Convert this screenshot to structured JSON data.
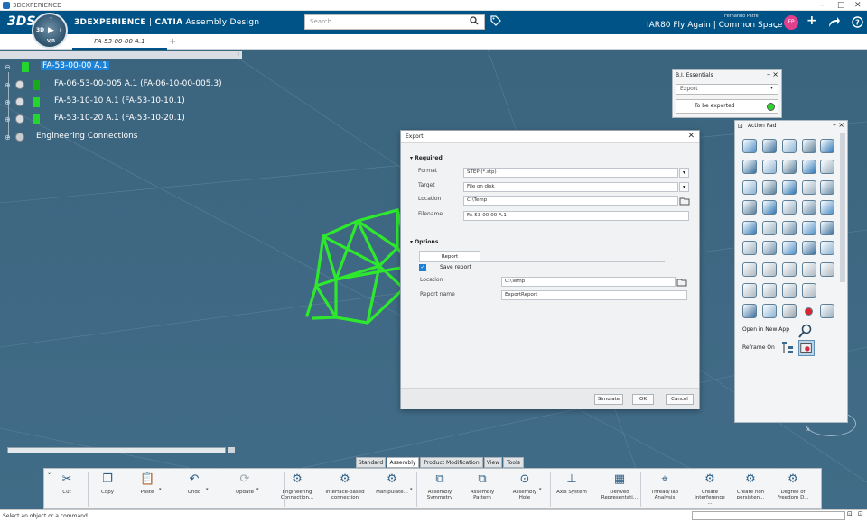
{
  "window": {
    "title": "3DEXPERIENCE",
    "controls": [
      "–",
      "□",
      "✕"
    ]
  },
  "header": {
    "logo": "3DS",
    "compass": {
      "top": "?",
      "center": "▶",
      "bottom": "V,R",
      "left": "3D",
      "right": "i"
    },
    "brand": "3DEXPERIENCE",
    "app": "CATIA",
    "app_module": "Assembly Design",
    "search_placeholder": "Search",
    "user_name": "Fernando Patre",
    "collab_space": "IAR80 Fly Again | Common Space",
    "avatar_initials": "FP"
  },
  "tabs": {
    "document": "FA-53-00-00 A.1",
    "add": "+"
  },
  "tree": {
    "root": "FA-53-00-00 A.1",
    "items": [
      "FA-06-53-00-005 A.1 (FA-06-10-00-005.3)",
      "FA-53-10-10 A.1 (FA-53-10-10.1)",
      "FA-53-10-20 A.1 (FA-53-10-20.1)",
      "Engineering Connections"
    ],
    "collapse_icon": "‹"
  },
  "bi_essentials": {
    "title": "B.I. Essentials",
    "selected": "Export",
    "legend": "To be exported",
    "legend_color": "#2cd52c"
  },
  "action_pad": {
    "title": "Action Pad",
    "open_new_app": "Open in New App",
    "reframe_on": "Reframe On"
  },
  "export_dialog": {
    "title": "Export",
    "required_label": "Required",
    "format_label": "Format",
    "format_value": "STEP (*.stp)",
    "target_label": "Target",
    "target_value": "File on disk",
    "location_label": "Location",
    "location_value": "C:\\Temp",
    "filename_label": "Filename",
    "filename_value": "FA-53-00-00 A.1",
    "options_label": "Options",
    "report_tab": "Report",
    "save_report_label": "Save report",
    "report_location_label": "Location",
    "report_location_value": "C:\\Temp",
    "report_name_label": "Report name",
    "report_name_value": "ExportReport",
    "simulate": "Simulate",
    "ok": "OK",
    "cancel": "Cancel"
  },
  "section_tabs": [
    "Standard",
    "Assembly",
    "Product Modification",
    "View",
    "Tools"
  ],
  "toolbar": [
    {
      "label": "Cut"
    },
    {
      "label": "Copy"
    },
    {
      "label": "Paste"
    },
    {
      "label": "Undo"
    },
    {
      "label": "Update"
    },
    {
      "label": "Engineering Connection..."
    },
    {
      "label": "Interface-based connection"
    },
    {
      "label": "Manipulate..."
    },
    {
      "label": "Assembly Symmetry"
    },
    {
      "label": "Assembly Pattern"
    },
    {
      "label": "Assembly Hole"
    },
    {
      "label": "Axis System"
    },
    {
      "label": "Derived Representati..."
    },
    {
      "label": "Thread/Tap Analysis"
    },
    {
      "label": "Create interference ..."
    },
    {
      "label": "Create non persisten..."
    },
    {
      "label": "Degree of Freedom D..."
    }
  ],
  "status": {
    "text": "Select an object or a command"
  },
  "colors": {
    "header": "#005386",
    "viewport": "#3f6680",
    "model": "#2ee82e",
    "accent": "#1e83d6"
  }
}
